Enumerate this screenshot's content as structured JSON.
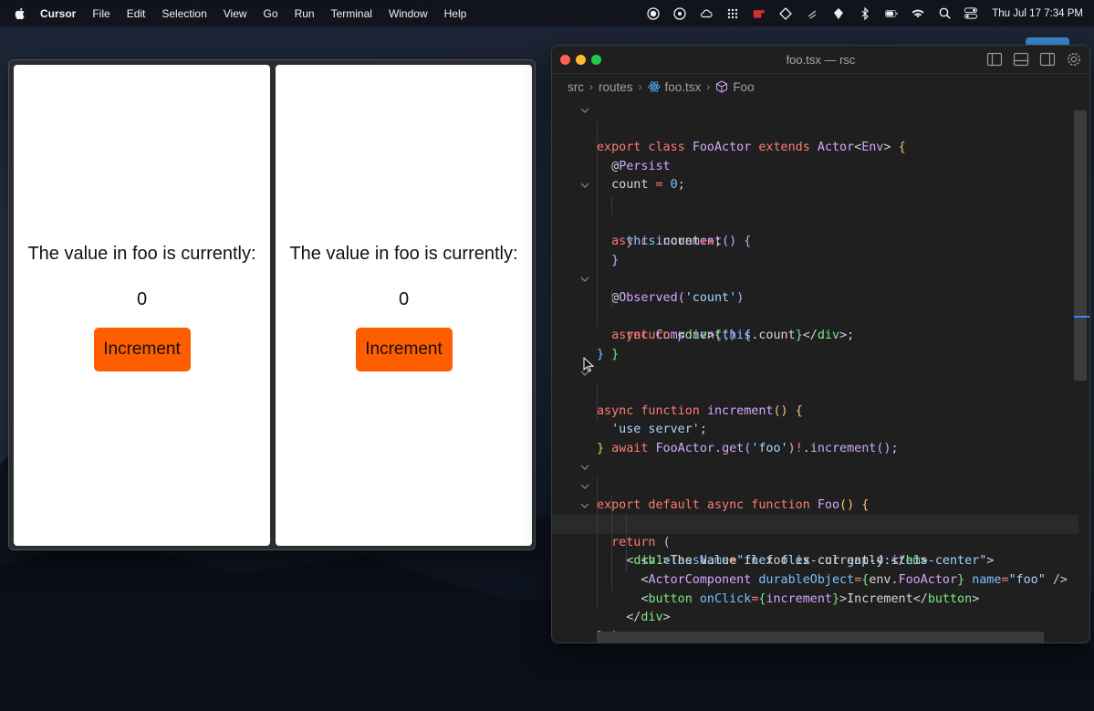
{
  "menubar": {
    "app_name": "Cursor",
    "items": [
      "File",
      "Edit",
      "Selection",
      "View",
      "Go",
      "Run",
      "Terminal",
      "Window",
      "Help"
    ],
    "clock": "Thu Jul 17  7:34 PM"
  },
  "preview": {
    "panes": [
      {
        "heading": "The value in foo is currently:",
        "value": "0",
        "button_label": "Increment"
      },
      {
        "heading": "The value in foo is currently:",
        "value": "0",
        "button_label": "Increment"
      }
    ],
    "button_color": "#ff5e00"
  },
  "editor": {
    "window_title": "foo.tsx — rsc",
    "breadcrumb": [
      "src",
      "routes",
      "foo.tsx",
      "Foo"
    ],
    "code_lines": [
      "export class FooActor extends Actor<Env> {",
      "  @Persist",
      "  count = 0;",
      "",
      "  async increment() {",
      "    this.count++;",
      "  }",
      "",
      "  @Observed('count')",
      "  async Component() {",
      "    return <div>{this.count}</div>;",
      "  }",
      "}",
      "",
      "async function increment() {",
      "  'use server';",
      "  await FooActor.get('foo')!.increment();",
      "}",
      "",
      "export default async function Foo() {",
      "  return (",
      "    <div className=\"flex flex-col gap-4 items-center\">",
      "      <h1>The value in foo is currently:</h1>",
      "      <ActorComponent durableObject={env.FooActor} name=\"foo\" />",
      "      <button onClick={increment}>Increment</button>",
      "    </div>",
      "  );",
      "}"
    ]
  }
}
